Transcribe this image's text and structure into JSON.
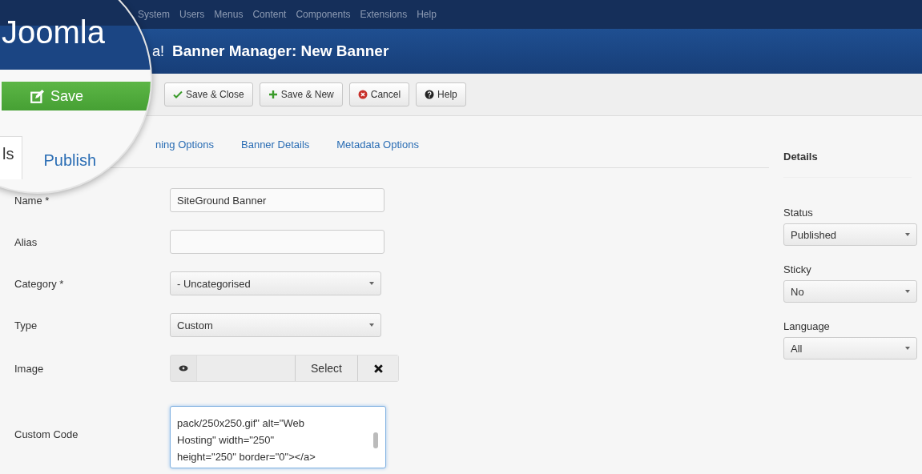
{
  "top_menu": [
    "System",
    "Users",
    "Menus",
    "Content",
    "Components",
    "Extensions",
    "Help"
  ],
  "logo_tail": "a!",
  "page_title": "Banner Manager: New Banner",
  "toolbar": [
    {
      "label": "Save & Close"
    },
    {
      "label": "Save & New"
    },
    {
      "label": "Cancel"
    },
    {
      "label": "Help"
    }
  ],
  "tabs": [
    {
      "label": "ning Options",
      "selected": false
    },
    {
      "label": "Banner Details",
      "selected": false
    },
    {
      "label": "Metadata Options",
      "selected": false
    }
  ],
  "fields": [
    {
      "kind": "text",
      "label": "Name *",
      "value": "SiteGround Banner"
    },
    {
      "kind": "text",
      "label": "Alias"
    },
    {
      "kind": "select",
      "label": "Category *",
      "value": "- Uncategorised"
    },
    {
      "kind": "select",
      "label": "Type",
      "value": "Custom"
    },
    {
      "kind": "media",
      "label": "Image",
      "button": "Select"
    },
    {
      "kind": "textarea",
      "label": "Custom Code",
      "value": "pack/250x250.gif\" alt=\"Web\nHosting\" width=\"250\"\nheight=\"250\" border=\"0\"></a>"
    }
  ],
  "details": {
    "title": "Details",
    "fields": [
      {
        "label": "Status",
        "value": "Published"
      },
      {
        "label": "Sticky",
        "value": "No"
      },
      {
        "label": "Language",
        "value": "All"
      }
    ]
  },
  "lens": {
    "logo": "Joomla",
    "save_button": "Save",
    "tabs": [
      {
        "label": "ls",
        "selected": true
      },
      {
        "label": "Publish",
        "selected": false
      }
    ]
  }
}
